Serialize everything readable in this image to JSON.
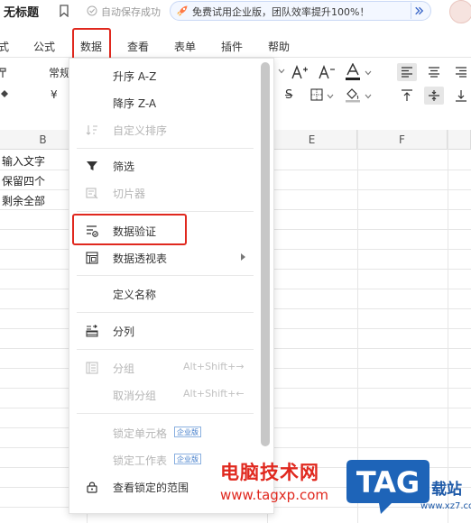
{
  "titlebar": {
    "doc_title": "无标题",
    "save_status": "自动保存成功",
    "promo_text": "免费试用企业版，团队效率提升100%！"
  },
  "menubar": {
    "tabs": [
      "式",
      "公式",
      "数据",
      "查看",
      "表单",
      "插件",
      "帮助"
    ]
  },
  "toolbar": {
    "number_format": "常规",
    "currency_symbol": "¥",
    "strike_symbol": "S"
  },
  "grid": {
    "columns": [
      "B",
      "E",
      "F"
    ],
    "cells": [
      "输入文字",
      "保留四个",
      "剩余全部"
    ]
  },
  "dropdown": {
    "items": [
      {
        "label": "升序 A-Z",
        "disabled": false,
        "icon": "none"
      },
      {
        "label": "降序 Z-A",
        "disabled": false,
        "icon": "none"
      },
      {
        "label": "自定义排序",
        "disabled": true,
        "icon": "sort-icon"
      },
      {
        "label": "筛选",
        "disabled": false,
        "icon": "filter-icon"
      },
      {
        "label": "切片器",
        "disabled": true,
        "icon": "slicer-icon"
      },
      {
        "label": "数据验证",
        "disabled": false,
        "icon": "data-validation-icon"
      },
      {
        "label": "数据透视表",
        "disabled": false,
        "icon": "pivot-table-icon",
        "submenu": true
      },
      {
        "label": "定义名称",
        "disabled": false,
        "icon": "none"
      },
      {
        "label": "分列",
        "disabled": false,
        "icon": "split-column-icon"
      },
      {
        "label": "分组",
        "disabled": true,
        "icon": "group-icon",
        "shortcut": "Alt+Shift+→"
      },
      {
        "label": "取消分组",
        "disabled": true,
        "icon": "none",
        "shortcut": "Alt+Shift+←"
      },
      {
        "label": "锁定单元格",
        "disabled": true,
        "icon": "none",
        "badge": "企业版"
      },
      {
        "label": "锁定工作表",
        "disabled": true,
        "icon": "none",
        "badge": "企业版"
      },
      {
        "label": "查看锁定的范围",
        "disabled": false,
        "icon": "lock-icon"
      }
    ]
  },
  "watermark": {
    "brand": "电脑技术网",
    "url": "www.tagxp.com",
    "logo_text": "TAG",
    "side_text": "载站",
    "side_url": "www.xz7.com"
  },
  "colors": {
    "highlight": "#e0281e",
    "logo_blue": "#1e64b8"
  }
}
